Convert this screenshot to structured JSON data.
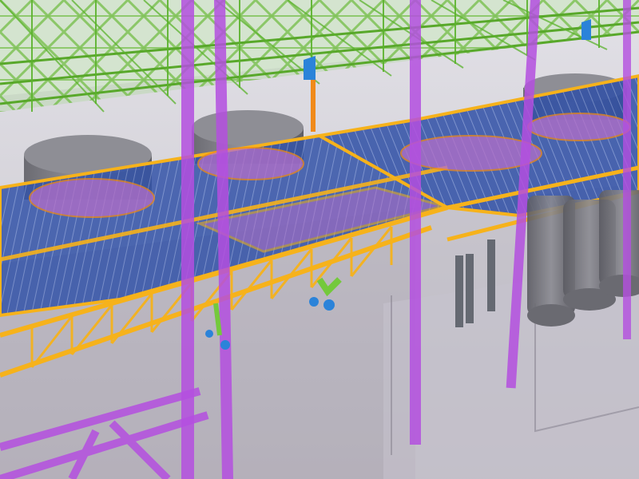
{
  "scene": {
    "kind": "bim-3d-model-view",
    "colors": {
      "background": "#ecebef",
      "building_shell": "#b9b7c0",
      "upper_truss": "#5fb52a",
      "main_platform_frame": "#f6b21b",
      "platform_grating": "#2f4fa6",
      "tank_cylinder": "#7f7f86",
      "opening_in_floor": "#b56fc9",
      "columns": "#b44fe0",
      "pipe_orange": "#f08a1a",
      "equipment_blue": "#2b83d9",
      "equipment_green": "#74c93c"
    },
    "elements": [
      "building-shell",
      "upper-green-truss-deck",
      "storage-tanks",
      "main-platform",
      "platform-openings",
      "purple-columns",
      "purple-diagonal-braces",
      "lower-tall-tanks",
      "support-legs",
      "hanging-equipment"
    ]
  }
}
